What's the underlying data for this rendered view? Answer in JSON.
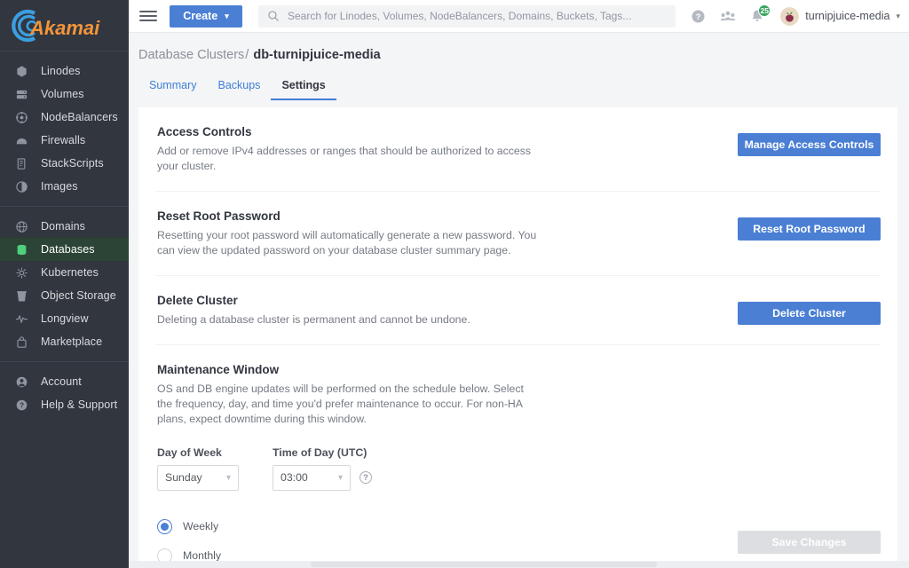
{
  "brand": {
    "name": "Akamai",
    "swoosh_color": "#3b9ee0",
    "wordmark_color": "#f2953a"
  },
  "colors": {
    "accent_blue": "#4a7fd4",
    "sidebar_bg": "#32363f",
    "active_green": "#4ed07c",
    "badge_green": "#3aa35f"
  },
  "topbar": {
    "menu_icon": "hamburger-icon",
    "create_label": "Create",
    "create_caret": "▾",
    "search_placeholder": "Search for Linodes, Volumes, NodeBalancers, Domains, Buckets, Tags...",
    "search_value": "",
    "help_icon": "help-circle-icon",
    "community_icon": "community-users-icon",
    "notifications_icon": "bell-icon",
    "notifications_count": "25",
    "username": "turnipjuice-media",
    "user_caret": "▾"
  },
  "sidebar": {
    "groups": [
      {
        "items": [
          {
            "label": "Linodes",
            "icon": "linode-cube-icon",
            "active": false
          },
          {
            "label": "Volumes",
            "icon": "volumes-icon",
            "active": false
          },
          {
            "label": "NodeBalancers",
            "icon": "nodebalancers-icon",
            "active": false
          },
          {
            "label": "Firewalls",
            "icon": "firewall-icon",
            "active": false
          },
          {
            "label": "StackScripts",
            "icon": "stackscripts-icon",
            "active": false
          },
          {
            "label": "Images",
            "icon": "images-icon",
            "active": false
          }
        ]
      },
      {
        "items": [
          {
            "label": "Domains",
            "icon": "globe-icon",
            "active": false
          },
          {
            "label": "Databases",
            "icon": "database-icon",
            "active": true
          },
          {
            "label": "Kubernetes",
            "icon": "kubernetes-icon",
            "active": false
          },
          {
            "label": "Object Storage",
            "icon": "object-storage-icon",
            "active": false
          },
          {
            "label": "Longview",
            "icon": "longview-pulse-icon",
            "active": false
          },
          {
            "label": "Marketplace",
            "icon": "marketplace-bag-icon",
            "active": false
          }
        ]
      },
      {
        "items": [
          {
            "label": "Account",
            "icon": "account-person-icon",
            "active": false
          },
          {
            "label": "Help & Support",
            "icon": "help-circle-icon",
            "active": false
          }
        ]
      }
    ]
  },
  "breadcrumb": {
    "parent": "Database Clusters",
    "separator": "/",
    "current": "db-turnipjuice-media"
  },
  "tabs": [
    {
      "label": "Summary",
      "active": false
    },
    {
      "label": "Backups",
      "active": false
    },
    {
      "label": "Settings",
      "active": true
    }
  ],
  "sections": {
    "access_controls": {
      "title": "Access Controls",
      "description": "Add or remove IPv4 addresses or ranges that should be authorized to access your cluster.",
      "button": "Manage Access Controls"
    },
    "reset_root_password": {
      "title": "Reset Root Password",
      "description": "Resetting your root password will automatically generate a new password. You can view the updated password on your database cluster summary page.",
      "button": "Reset Root Password"
    },
    "delete_cluster": {
      "title": "Delete Cluster",
      "description": "Deleting a database cluster is permanent and cannot be undone.",
      "button": "Delete Cluster"
    },
    "maintenance_window": {
      "title": "Maintenance Window",
      "description": "OS and DB engine updates will be performed on the schedule below. Select the frequency, day, and time you'd prefer maintenance to occur. For non-HA plans, expect downtime during this window.",
      "day_label": "Day of Week",
      "day_value": "Sunday",
      "time_label": "Time of Day (UTC)",
      "time_value": "03:00",
      "help_icon": "help-circle-icon",
      "caret": "▾",
      "frequency_options": [
        {
          "label": "Weekly",
          "selected": true
        },
        {
          "label": "Monthly",
          "selected": false
        }
      ],
      "save_button": "Save Changes",
      "save_disabled": true
    }
  }
}
